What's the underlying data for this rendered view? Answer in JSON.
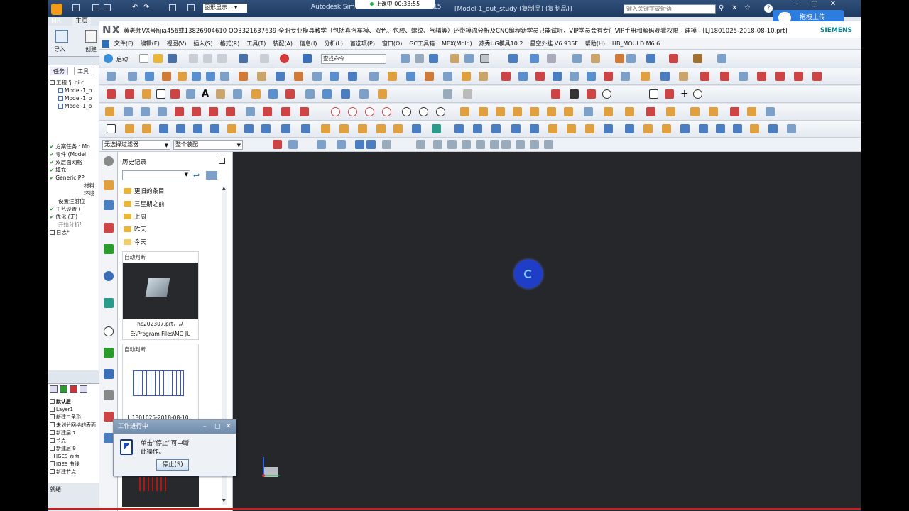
{
  "sim": {
    "app_title": "Autodesk Sim",
    "title_suffix": "15",
    "doc_title": "[Model-1_out_study (复制品) (复制品)]",
    "upload_status": "上课中 00:33:55",
    "search_placeholder": "键入关键字或短语",
    "cloud_upload": "拖拽上传",
    "tabs": [
      "MR",
      "主页"
    ],
    "ribbon_import": "导入",
    "ribbon_create": "创建"
  },
  "nx": {
    "logo": "NX",
    "title": "黄老师VX号hjia456或13826904610 QQ3321637639 全职专业模具教学（包括真汽车模、双色、包胶、螺纹、气辅等）还带模流分析及CNC编程新学员只能试听，VIP学员会有专门VIP手册和解码观看权限 - 建模 - [LJ1801025-2018-08-10.prt]",
    "brand": "SIEMENS",
    "menus": [
      "文件(F)",
      "编辑(E)",
      "视图(V)",
      "插入(S)",
      "格式(R)",
      "工具(T)",
      "装配(A)",
      "信息(I)",
      "分析(L)",
      "首选项(P)",
      "窗口(O)",
      "GC工具箱",
      "MEX(Mold)",
      "燕秀UG模具10.2",
      "星空外挂 V6.935F",
      "帮助(H)",
      "HB_MOULD M6.6"
    ],
    "start_label": "启动",
    "command_search": "查找命令",
    "filter_select": "无选择过滤器",
    "assembly_select": "整个装配"
  },
  "navigator": {
    "tabs": [
      "任务",
      "工具"
    ],
    "tree": [
      "工程 'ji qi c",
      "Model-1_o",
      "Model-1_o",
      "Model-1_o"
    ],
    "task_tree": [
      "方案任务 : Mo",
      "零件 (Model",
      "双层面网格",
      "填充",
      "Generic PP",
      "材料",
      "环境",
      "设置注射位",
      "工艺设置 (",
      "优化 (无)",
      "开始分析!",
      "日志*"
    ]
  },
  "layers": [
    "默认层",
    "Layer1",
    "新建三角形",
    "未划分网格的表面",
    "新建层 7",
    "节点",
    "新建层 9",
    "IGES 表面",
    "IGES 曲线",
    "新建节点"
  ],
  "sim_status": "就绪",
  "history": {
    "title": "历史记录",
    "folders": [
      "更旧的条目",
      "三星期之前",
      "上周",
      "昨天",
      "今天"
    ],
    "cards": [
      {
        "header": "自动判断",
        "caption1": "hc202307.prt，从",
        "caption2": "E:\\Program Files\\MO  JU"
      },
      {
        "header": "自动判断",
        "caption1": "LJ1801025-2018-08-10...",
        "caption2": ""
      }
    ]
  },
  "work_dialog": {
    "title": "工作进行中",
    "message_line1": "单击“停止”可中断",
    "message_line2": "此操作。",
    "stop_label": "停止(S)"
  },
  "colors": {
    "viewport": "#26272b",
    "spinner": "#1e3ec8",
    "accent": "#2d7de0"
  }
}
